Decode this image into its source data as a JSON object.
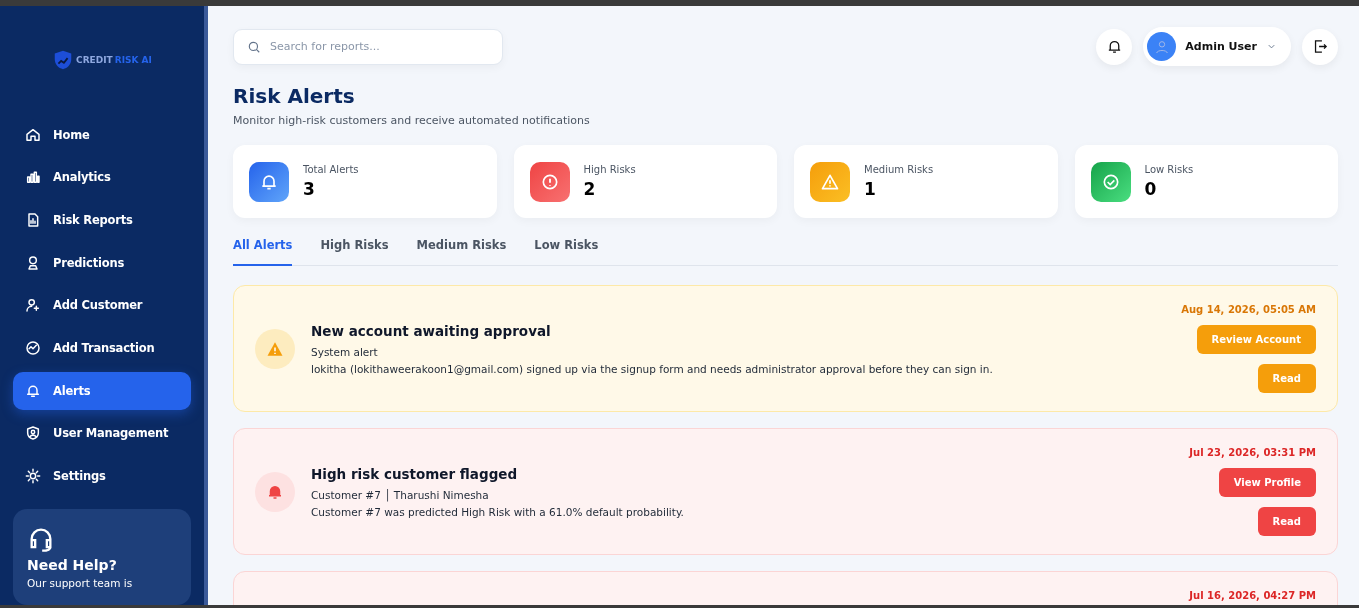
{
  "sidebar": {
    "logo": {
      "word_1": "CREDIT",
      "word_2": "RISK AI"
    },
    "items": [
      {
        "label": "Home",
        "selected": false
      },
      {
        "label": "Analytics",
        "selected": false
      },
      {
        "label": "Risk Reports",
        "selected": false
      },
      {
        "label": "Predictions",
        "selected": false
      },
      {
        "label": "Add Customer",
        "selected": false
      },
      {
        "label": "Add Transaction",
        "selected": false
      },
      {
        "label": "Alerts",
        "selected": true
      },
      {
        "label": "User Management",
        "selected": false
      },
      {
        "label": "Settings",
        "selected": false
      }
    ],
    "help": {
      "title": "Need Help?",
      "text": "Our support team is"
    }
  },
  "header": {
    "search": {
      "placeholder": "Search for reports..."
    },
    "user": {
      "name": "Admin User"
    }
  },
  "page": {
    "title": "Risk Alerts",
    "subtitle": "Monitor high-risk customers and receive automated notifications"
  },
  "stats": [
    {
      "kind": "total",
      "label": "Total Alerts",
      "value": "3"
    },
    {
      "kind": "high",
      "label": "High Risks",
      "value": "2"
    },
    {
      "kind": "medium",
      "label": "Medium Risks",
      "value": "1"
    },
    {
      "kind": "low",
      "label": "Low Risks",
      "value": "0"
    }
  ],
  "tabs": [
    {
      "label": "All Alerts",
      "selected": true
    },
    {
      "label": "High Risks",
      "selected": false
    },
    {
      "label": "Medium Risks",
      "selected": false
    },
    {
      "label": "Low Risks",
      "selected": false
    }
  ],
  "alerts": [
    {
      "kind": "warning",
      "title": "New account awaiting approval",
      "source": "System alert",
      "message": "lokitha (lokithaweerakoon1@gmail.com) signed up via the signup form and needs administrator approval before they can sign in.",
      "date": "Aug 14, 2026, 05:05 AM",
      "buttons": [
        "Review Account",
        "Read"
      ]
    },
    {
      "kind": "danger",
      "title": "High risk customer flagged",
      "source": "Customer #7 │ Tharushi Nimesha",
      "message": "Customer #7 was predicted High Risk with a 61.0% default probability.",
      "date": "Jul 23, 2026, 03:31 PM",
      "buttons": [
        "View Profile",
        "Read"
      ]
    },
    {
      "kind": "danger",
      "date": "Jul 16, 2026, 04:27 PM"
    }
  ]
}
